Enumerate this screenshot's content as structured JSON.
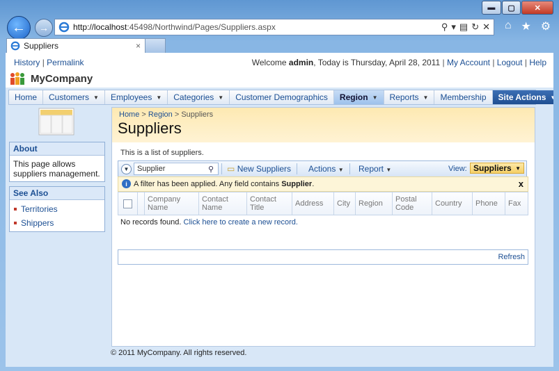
{
  "browser": {
    "url_host": "http://localhost",
    "url_rest": ":45498/Northwind/Pages/Suppliers.aspx",
    "tab_title": "Suppliers",
    "tab_close": "×"
  },
  "topbar": {
    "history": "History",
    "sep": "|",
    "permalink": "Permalink",
    "welcome_prefix": "Welcome",
    "user": "admin",
    "welcome_suffix": ", Today is Thursday, April 28, 2011",
    "my_account": "My Account",
    "logout": "Logout",
    "help": "Help"
  },
  "brand": {
    "name": "MyCompany"
  },
  "menu": {
    "items": [
      {
        "label": "Home"
      },
      {
        "label": "Customers"
      },
      {
        "label": "Employees"
      },
      {
        "label": "Categories"
      },
      {
        "label": "Customer Demographics"
      },
      {
        "label": "Region"
      },
      {
        "label": "Reports"
      },
      {
        "label": "Membership"
      },
      {
        "label": "Site Actions"
      }
    ],
    "selected": "Region"
  },
  "sidebar": {
    "about_title": "About",
    "about_text": "This page allows suppliers management.",
    "see_also_title": "See Also",
    "links": [
      "Territories",
      "Shippers"
    ]
  },
  "content": {
    "breadcrumb": [
      "Home",
      "Region",
      "Suppliers"
    ],
    "crumb_sep": ">",
    "title": "Suppliers",
    "description": "This is a list of suppliers."
  },
  "grid": {
    "search_value": "Supplier",
    "new_label": "New Suppliers",
    "actions_label": "Actions",
    "report_label": "Report",
    "view_label": "View:",
    "view_value": "Suppliers",
    "filter_text": "A filter has been applied. Any field contains",
    "filter_value": "Supplier",
    "filter_end": ".",
    "close": "x",
    "columns": [
      "Company Name",
      "Contact Name",
      "Contact Title",
      "Address",
      "City",
      "Region",
      "Postal Code",
      "Country",
      "Phone",
      "Fax"
    ],
    "no_records": "No records found.",
    "create_link": "Click here to create a new record.",
    "refresh": "Refresh"
  },
  "footer": {
    "copyright": "© 2011 MyCompany. All rights reserved."
  },
  "colors": {
    "accent": "#1c4f93",
    "highlight": "#fde9b2"
  }
}
